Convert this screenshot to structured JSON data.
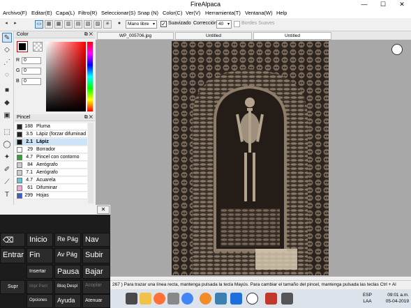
{
  "window": {
    "title": "FireAlpaca",
    "minimize": "—",
    "maximize": "☐",
    "close": "✕"
  },
  "menu": [
    "Archivo(F)",
    "Editar(E)",
    "Capa(L)",
    "Filtro(R)",
    "Seleccionar(S)",
    "Snap (N)",
    "Color(C)",
    "Ver(V)",
    "Herramienta(T)",
    "Ventana(W)",
    "Help"
  ],
  "toolbar": {
    "mode_value": "Mano libre",
    "smoothing_label": "Suavizado",
    "smoothing_checked": "✓",
    "correction_label": "Corrección",
    "correction_value": "40",
    "soft_edges_label": "Bordes Suaves"
  },
  "color_panel": {
    "title": "Color",
    "r_label": "R",
    "g_label": "G",
    "b_label": "B",
    "r": "0",
    "g": "0",
    "b": "0"
  },
  "brush_panel": {
    "title": "Pincel",
    "items": [
      {
        "size": "188",
        "name": "Pluma",
        "color": "#222222"
      },
      {
        "size": "3.5",
        "name": "Lápiz (forzar difuminad",
        "color": "#222222"
      },
      {
        "size": "2.1",
        "name": "Lápiz",
        "color": "#111111"
      },
      {
        "size": "29",
        "name": "Borrador",
        "color": "#ffffff"
      },
      {
        "size": "4.7",
        "name": "Pincel con contorno",
        "color": "#2fa52f"
      },
      {
        "size": "84",
        "name": "Aerógrafo",
        "color": "#cccccc"
      },
      {
        "size": "7.1",
        "name": "Aerógrafo",
        "color": "#cccccc"
      },
      {
        "size": "4.7",
        "name": "Acuarela",
        "color": "#5fc9d8"
      },
      {
        "size": "61",
        "name": "Difuminar",
        "color": "#f4a8d8"
      },
      {
        "size": "299",
        "name": "Hojas",
        "color": "#3a5fcd"
      }
    ]
  },
  "tabs": [
    "WP_005706.jpg",
    "Untitled",
    "Untitled"
  ],
  "status": {
    "text": "267 )  Para trazar una línea recta, mantenga pulsada la tecla Mayús. Para cambiar el tamaño del pincel, mantenga pulsada las teclas Ctrl + Al"
  },
  "keyboard": {
    "keys": [
      "⌫",
      "Inicio",
      "Re Pág",
      "Nav",
      "Entrar",
      "Fin",
      "Av Pág",
      "Subir",
      "Insertar",
      "Pausa",
      "Bajar",
      "Supr",
      "Impr Pant",
      "Bloq Despl",
      "Acoplar",
      "Opciones",
      "Ayuda",
      "Atenuar"
    ]
  },
  "taskbar": {
    "lang_top": "ESP",
    "lang_bottom": "LAA",
    "time": "09:01 a.m.",
    "date": "05-04-2019"
  }
}
